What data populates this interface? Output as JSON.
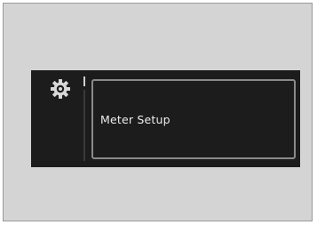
{
  "screen": {
    "icon": "gear-icon",
    "item_label": "Meter Setup",
    "colors": {
      "display_background": "#1c1c1c",
      "item_border": "#8a8a8a",
      "text": "#ededed"
    }
  }
}
